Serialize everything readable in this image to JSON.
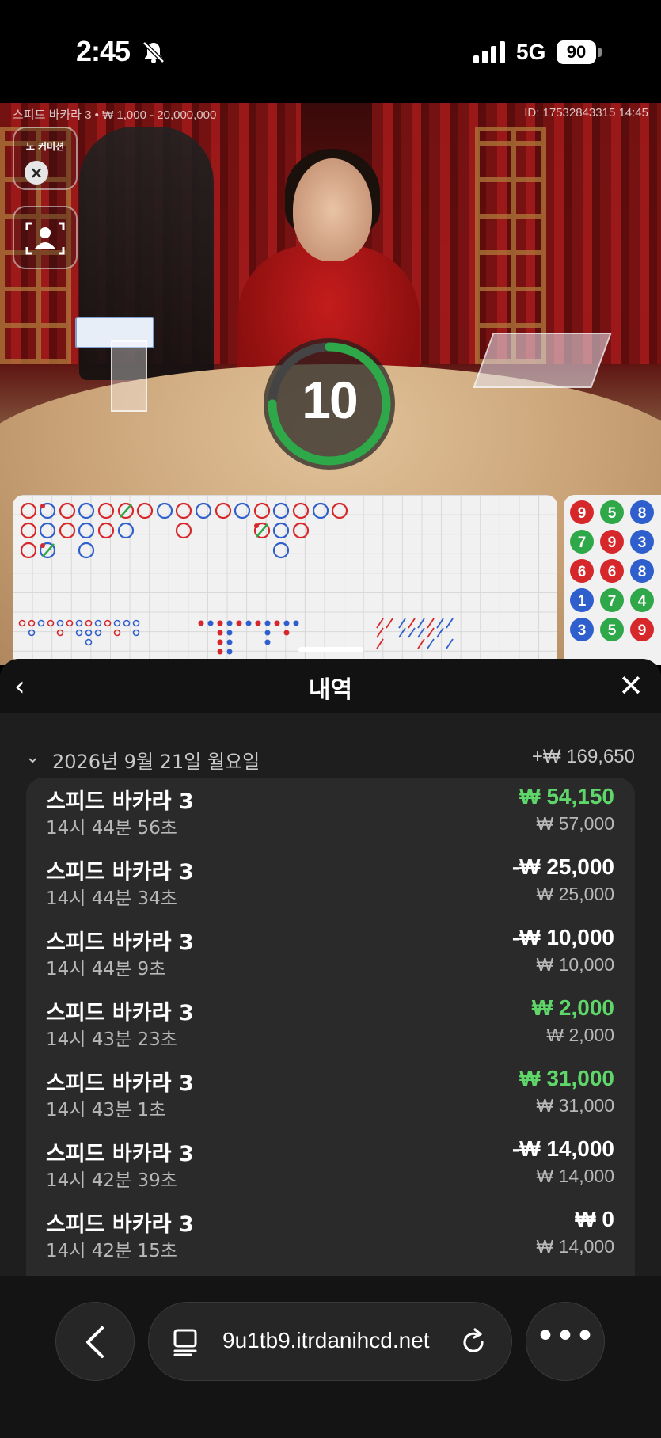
{
  "status_bar": {
    "time": "2:45",
    "network": "5G",
    "battery": "90"
  },
  "video": {
    "table_info": "스피드 바카라 3 • ₩ 1,000 - 20,000,000",
    "round_id": "ID: 17532843315 14:45",
    "no_commission_label": "노 커미션",
    "countdown": "10",
    "countdown_fraction": 0.75
  },
  "big_road_side": [
    [
      "9",
      "5",
      "8"
    ],
    [
      "7",
      "9",
      "3"
    ],
    [
      "6",
      "6",
      "8"
    ],
    [
      "1",
      "7",
      "4"
    ],
    [
      "3",
      "5",
      "9"
    ]
  ],
  "history": {
    "title": "내역",
    "date_group": {
      "date": "2026년 9월 21일 월요일",
      "total": "+₩ 169,650"
    },
    "items": [
      {
        "name": "스피드 바카라 3",
        "time": "14시 44분 56초",
        "result": "₩ 54,150",
        "stake": "₩ 57,000",
        "win": true
      },
      {
        "name": "스피드 바카라 3",
        "time": "14시 44분 34초",
        "result": "-₩ 25,000",
        "stake": "₩ 25,000",
        "win": false
      },
      {
        "name": "스피드 바카라 3",
        "time": "14시 44분 9초",
        "result": "-₩ 10,000",
        "stake": "₩ 10,000",
        "win": false
      },
      {
        "name": "스피드 바카라 3",
        "time": "14시 43분 23초",
        "result": "₩ 2,000",
        "stake": "₩ 2,000",
        "win": true
      },
      {
        "name": "스피드 바카라 3",
        "time": "14시 43분 1초",
        "result": "₩ 31,000",
        "stake": "₩ 31,000",
        "win": true
      },
      {
        "name": "스피드 바카라 3",
        "time": "14시 42분 39초",
        "result": "-₩ 14,000",
        "stake": "₩ 14,000",
        "win": false
      },
      {
        "name": "스피드 바카라 3",
        "time": "14시 42분 15초",
        "result": "₩ 0",
        "stake": "₩ 14,000",
        "win": false
      }
    ]
  },
  "browser": {
    "url": "9u1tb9.itrdanihcd.net"
  },
  "colors": {
    "win": "#5fd66a",
    "player": "#2f5fcc",
    "banker": "#d6282b",
    "timer_ring": "#2fa84a"
  }
}
